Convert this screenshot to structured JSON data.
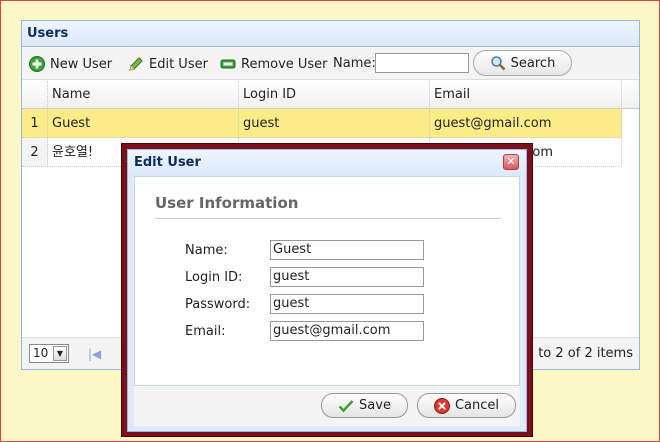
{
  "panel": {
    "title": "Users"
  },
  "toolbar": {
    "new_user": "New User",
    "edit_user": "Edit User",
    "remove_user": "Remove User",
    "name_label": "Name:",
    "name_value": "",
    "search": "Search"
  },
  "grid": {
    "columns": [
      "Name",
      "Login ID",
      "Email"
    ],
    "rows": [
      {
        "num": "1",
        "name": "Guest",
        "login": "guest",
        "email": "guest@gmail.com",
        "selected": true
      },
      {
        "num": "2",
        "name": "윤호열!",
        "login": "",
        "email": ".com",
        "selected": false
      }
    ]
  },
  "pager": {
    "page_size": "10",
    "info": "1 to 2 of 2 items"
  },
  "dialog": {
    "title": "Edit User",
    "section": "User Information",
    "fields": [
      {
        "label": "Name:",
        "value": "Guest"
      },
      {
        "label": "Login ID:",
        "value": "guest"
      },
      {
        "label": "Password:",
        "value": "guest"
      },
      {
        "label": "Email:",
        "value": "guest@gmail.com"
      }
    ],
    "save": "Save",
    "cancel": "Cancel"
  },
  "colors": {
    "page_bg": "#fdf9c7",
    "header_text": "#0e2d5f",
    "selected_row": "#fbec88",
    "modal_frame": "#7b0f1a"
  },
  "icons": {
    "new_user": "plus-icon",
    "edit_user": "pencil-icon",
    "remove_user": "minus-icon",
    "search": "magnifier-icon",
    "save": "check-icon",
    "cancel": "cancel-x-icon",
    "close": "close-icon",
    "pager_first": "first-page-icon"
  }
}
